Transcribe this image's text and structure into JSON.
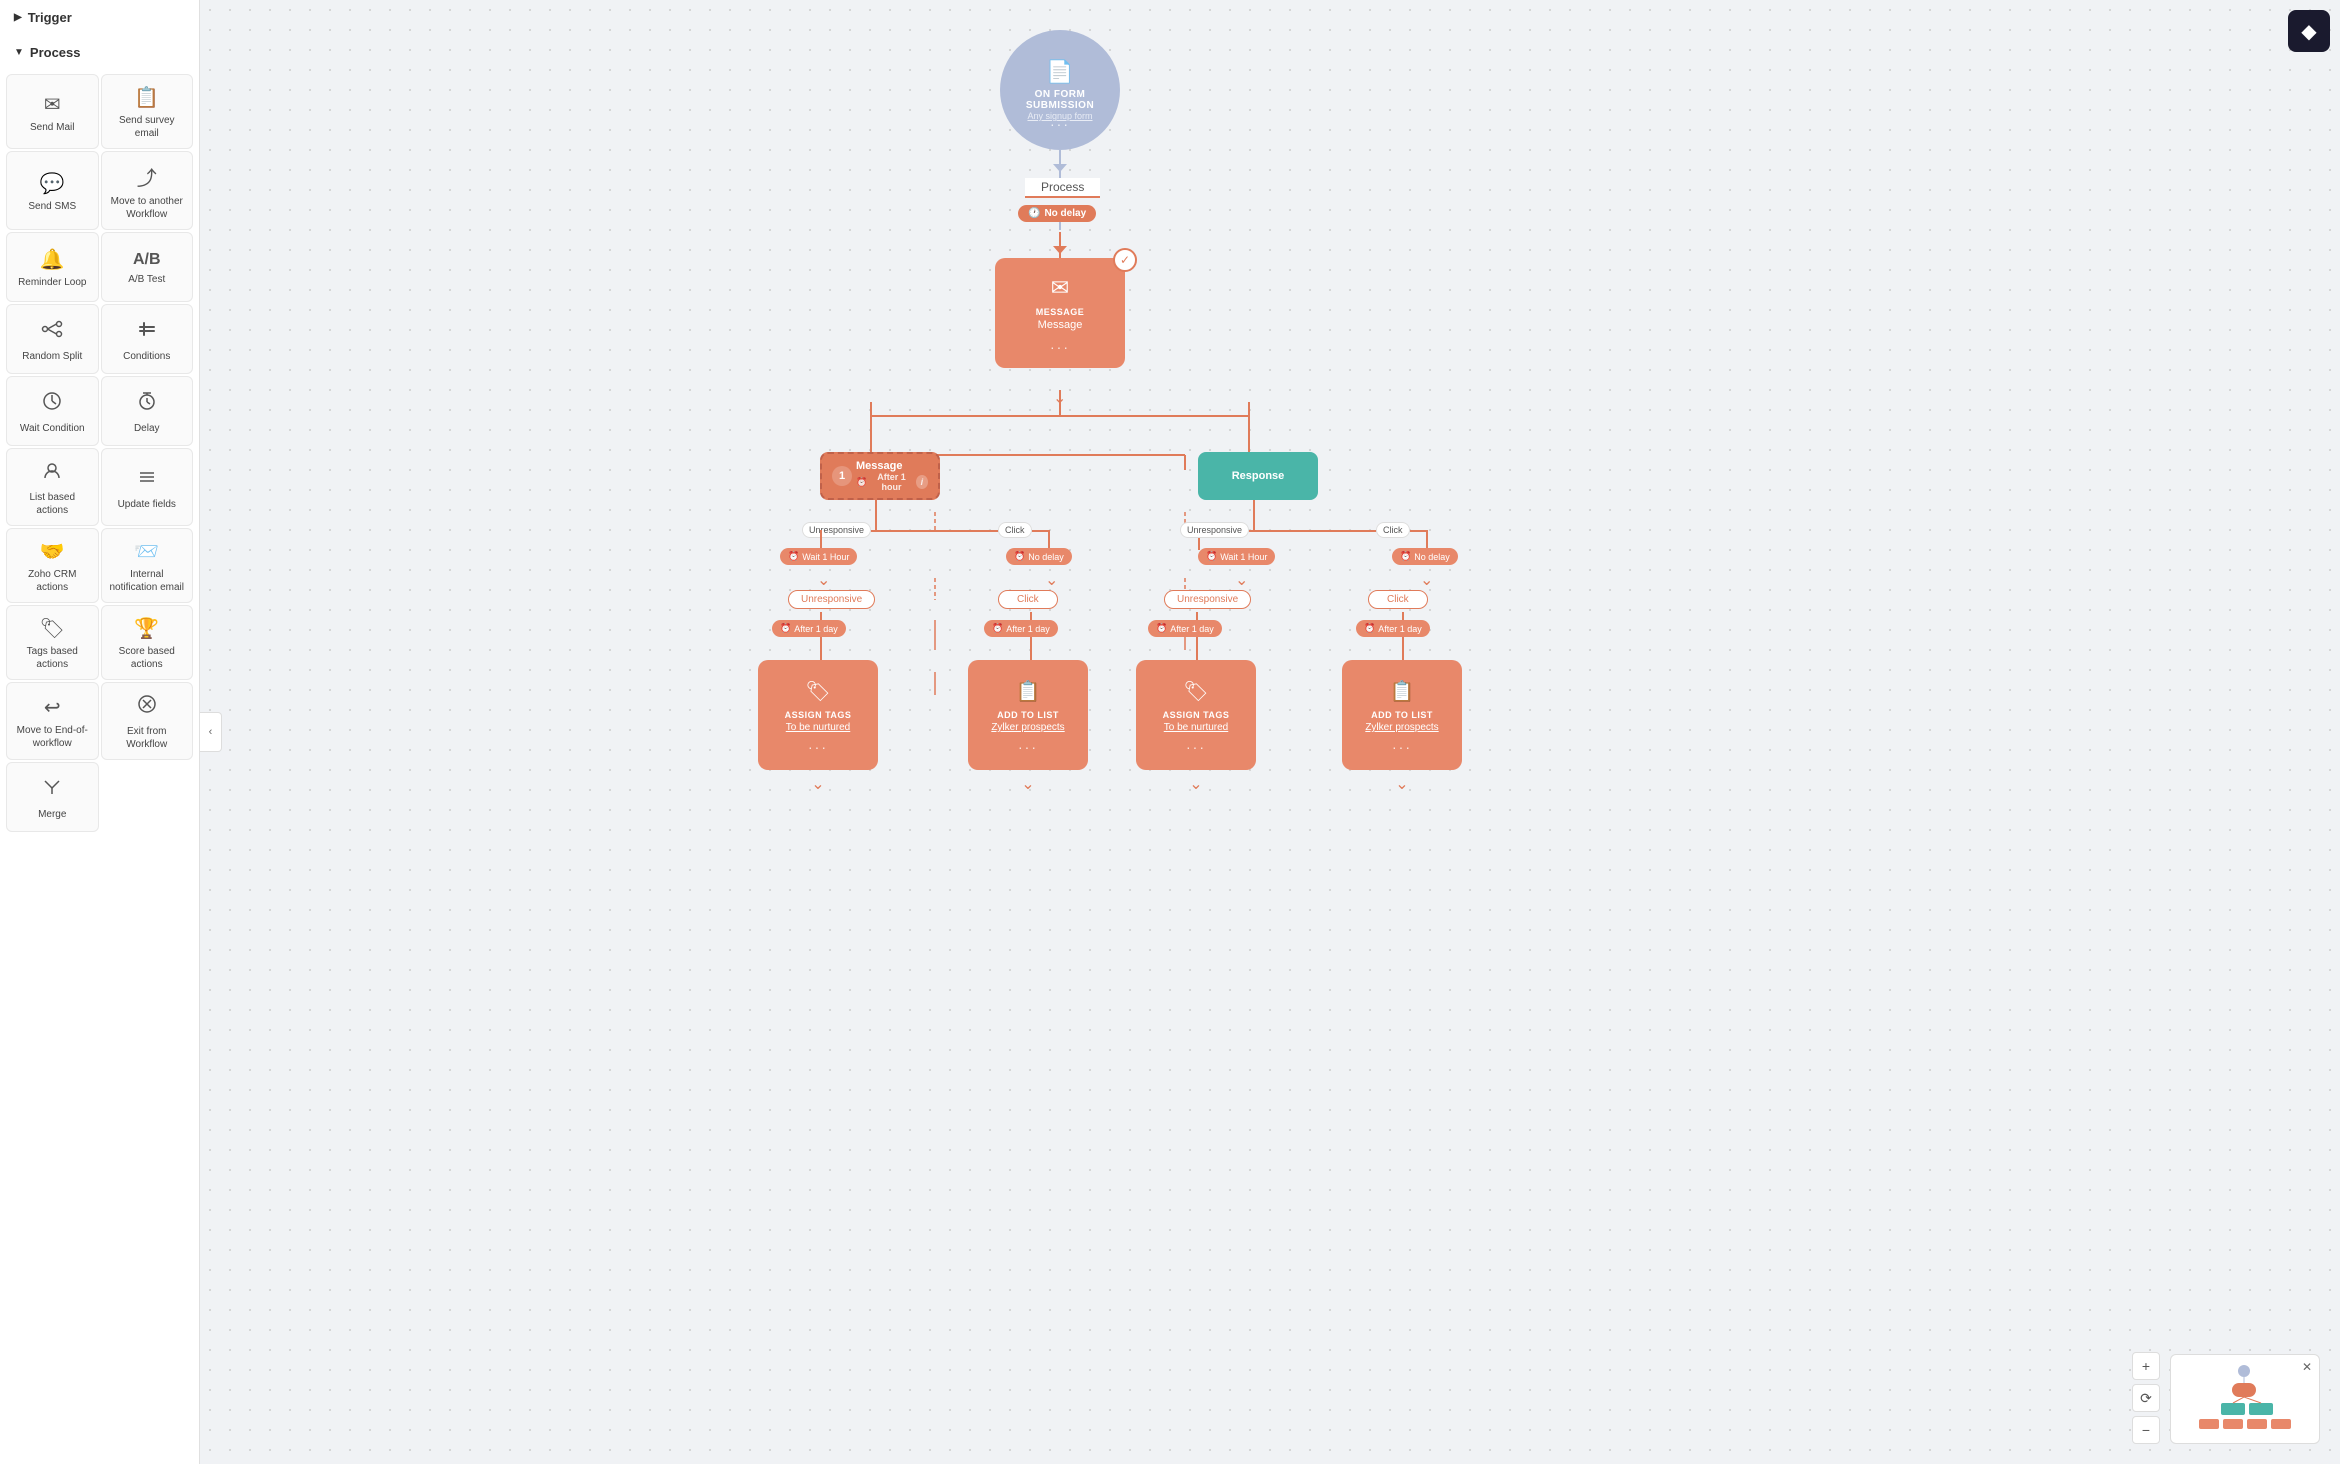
{
  "sidebar": {
    "trigger_label": "Trigger",
    "process_label": "Process",
    "items": [
      {
        "id": "send-mail",
        "label": "Send Mail",
        "icon": "✉",
        "stacked": false
      },
      {
        "id": "send-survey-email",
        "label": "Send survey email",
        "icon": "📋",
        "stacked": false
      },
      {
        "id": "send-sms",
        "label": "Send SMS",
        "icon": "💬",
        "stacked": false
      },
      {
        "id": "move-to-another-workflow",
        "label": "Move to another Workflow",
        "icon": "⤴",
        "stacked": false
      },
      {
        "id": "reminder-loop",
        "label": "Reminder Loop",
        "icon": "🔔",
        "stacked": true
      },
      {
        "id": "ab-test",
        "label": "A/B Test",
        "icon": "A/B",
        "stacked": false
      },
      {
        "id": "random-split",
        "label": "Random Split",
        "icon": "⑂",
        "stacked": false
      },
      {
        "id": "conditions",
        "label": "Conditions",
        "icon": "✦",
        "stacked": true
      },
      {
        "id": "wait-condition",
        "label": "Wait Condition",
        "icon": "⏳",
        "stacked": false
      },
      {
        "id": "delay",
        "label": "Delay",
        "icon": "⌛",
        "stacked": true
      },
      {
        "id": "list-based-actions",
        "label": "List based actions",
        "icon": "👥",
        "stacked": true
      },
      {
        "id": "update-fields",
        "label": "Update fields",
        "icon": "≡",
        "stacked": false
      },
      {
        "id": "zoho-crm-actions",
        "label": "Zoho CRM actions",
        "icon": "🤝",
        "stacked": true
      },
      {
        "id": "internal-notification-email",
        "label": "Internal notification email",
        "icon": "📨",
        "stacked": false
      },
      {
        "id": "tags-based-actions",
        "label": "Tags based actions",
        "icon": "🏷",
        "stacked": true
      },
      {
        "id": "score-based-actions",
        "label": "Score based actions",
        "icon": "🏆",
        "stacked": true
      },
      {
        "id": "move-to-end-of-workflow",
        "label": "Move to End-of-workflow",
        "icon": "↩",
        "stacked": false
      },
      {
        "id": "exit-from-workflow",
        "label": "Exit from Workflow",
        "icon": "✕",
        "stacked": false
      },
      {
        "id": "merge",
        "label": "Merge",
        "icon": "⇒",
        "stacked": false
      }
    ]
  },
  "workflow": {
    "trigger": {
      "title": "ON FORM SUBMISSION",
      "subtitle": "Any signup form",
      "dots": "···"
    },
    "process_label": "Process",
    "delay1": {
      "label": "No delay"
    },
    "message_node": {
      "title": "MESSAGE",
      "name": "Message",
      "dots": "···"
    },
    "branch_message": {
      "label": "Message",
      "delay": "After 1 hour"
    },
    "branch_response": {
      "label": "Response"
    },
    "unresponsive_label": "Unresponsive",
    "click_label": "Click",
    "wait_1hour": "Wait 1 Hour",
    "no_delay": "No delay",
    "unresponsive_tag": "Unresponsive",
    "click_tag": "Click",
    "assign_tags": {
      "delay": "After 1 day",
      "title": "ASSIGN TAGS",
      "name": "To be nurtured",
      "dots": "···"
    },
    "add_to_list": {
      "delay": "After 1 day",
      "title": "ADD TO LIST",
      "name": "Zylker prospects",
      "dots": "···"
    }
  },
  "colors": {
    "teal": "#4ab5a8",
    "salmon": "#e8886a",
    "orange": "#e07b5a",
    "blue_gray": "#b0bcd8",
    "dark": "#1a1a2e"
  }
}
